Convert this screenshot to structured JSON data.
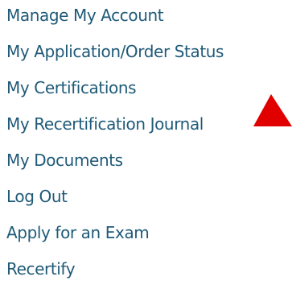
{
  "menu": {
    "items": [
      {
        "label": "Manage My Account"
      },
      {
        "label": "My Application/Order Status"
      },
      {
        "label": "My Certifications"
      },
      {
        "label": "My Recertification Journal"
      },
      {
        "label": "My Documents"
      },
      {
        "label": "Log Out"
      },
      {
        "label": "Apply for an Exam"
      },
      {
        "label": "Recertify"
      }
    ]
  },
  "pointer": {
    "icon": "red-triangle-arrow-icon",
    "color": "#e00000"
  },
  "colors": {
    "link": "#1f5a78",
    "background": "#ffffff"
  }
}
